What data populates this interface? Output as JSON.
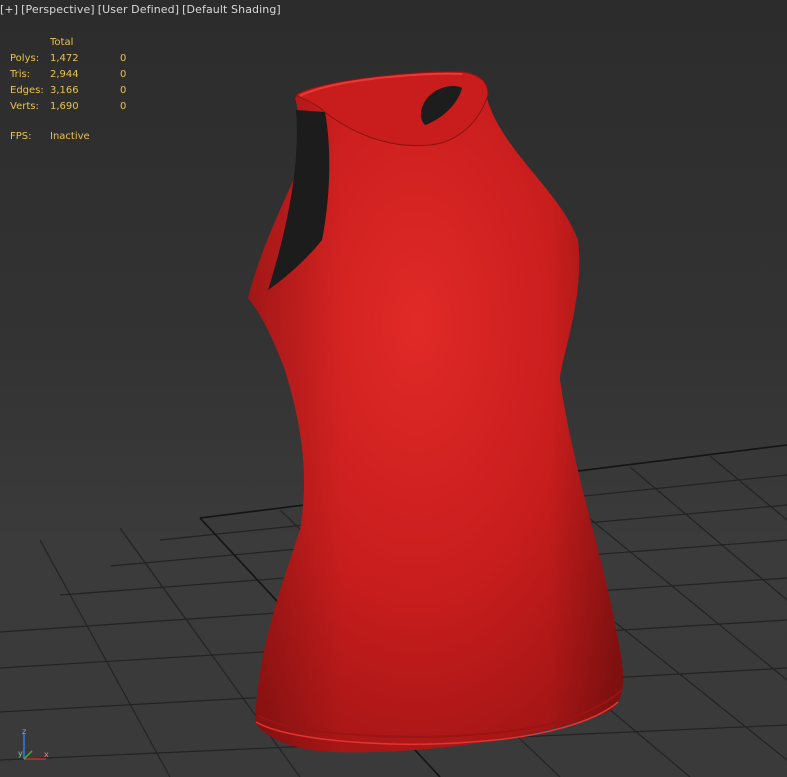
{
  "viewport": {
    "label_parts": [
      "[+]",
      "[Perspective]",
      "[User Defined]",
      "[Default Shading]"
    ]
  },
  "stats": {
    "header": "Total",
    "rows": [
      {
        "label": "Polys:",
        "total": "1,472",
        "selected": "0"
      },
      {
        "label": "Tris:",
        "total": "2,944",
        "selected": "0"
      },
      {
        "label": "Edges:",
        "total": "3,166",
        "selected": "0"
      },
      {
        "label": "Verts:",
        "total": "1,690",
        "selected": "0"
      }
    ],
    "fps_label": "FPS:",
    "fps_value": "Inactive"
  },
  "gizmo": {
    "x_label": "x",
    "y_label": "y",
    "z_label": "z"
  },
  "model": {
    "name": "red-halter-tank-top",
    "color": "#d02020"
  },
  "colors": {
    "stats_text": "#e9c34a",
    "label_text": "#d8d8d8",
    "grid_line": "#1e1e1e"
  }
}
